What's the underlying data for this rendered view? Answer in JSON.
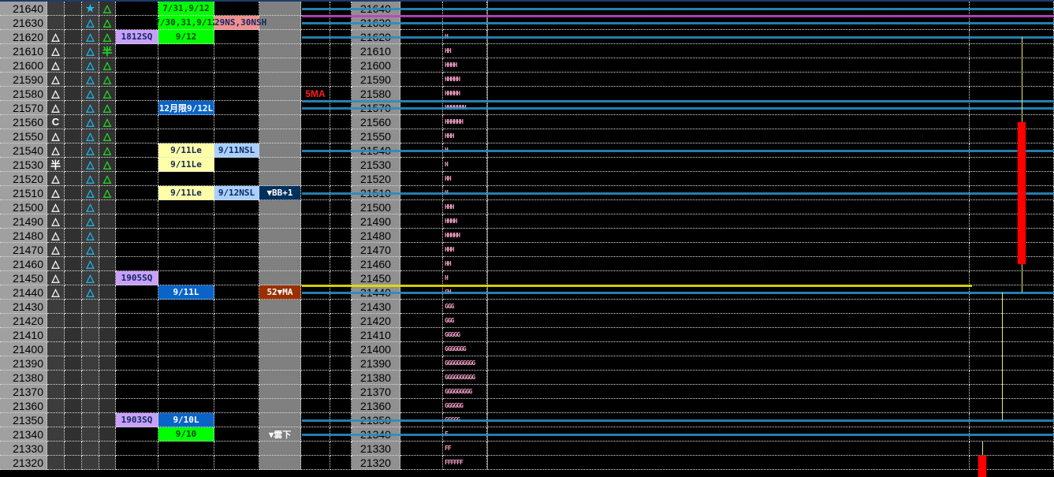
{
  "prices": [
    21640,
    21630,
    21620,
    21610,
    21600,
    21590,
    21580,
    21570,
    21560,
    21550,
    21540,
    21530,
    21520,
    21510,
    21500,
    21490,
    21480,
    21470,
    21460,
    21450,
    21440,
    21430,
    21420,
    21410,
    21400,
    21390,
    21380,
    21370,
    21360,
    21350,
    21340,
    21330,
    21320
  ],
  "marker_col_a": {
    "21620": "△",
    "21610": "△",
    "21600": "△",
    "21590": "△",
    "21580": "△",
    "21570": "△",
    "21560": "C",
    "21550": "△",
    "21540": "△",
    "21530": "半",
    "21520": "△",
    "21510": "△",
    "21500": "△",
    "21490": "△",
    "21480": "△",
    "21470": "△",
    "21460": "△",
    "21450": "△",
    "21440": "△"
  },
  "marker_col_b": {
    "21640": "★",
    "21630": "△",
    "21620": "△",
    "21610": "△",
    "21600": "△",
    "21590": "△",
    "21580": "△",
    "21570": "△",
    "21560": "△",
    "21550": "△",
    "21540": "△",
    "21530": "△",
    "21520": "△",
    "21510": "△",
    "21500": "△",
    "21490": "△",
    "21480": "△",
    "21470": "△",
    "21460": "△",
    "21450": "△",
    "21440": "△"
  },
  "marker_col_c": {
    "21640": "△",
    "21630": "△",
    "21620": "△",
    "21610": "半",
    "21600": "△",
    "21590": "△",
    "21580": "△",
    "21570": "△",
    "21560": "△",
    "21550": "△",
    "21540": "△",
    "21530": "△",
    "21520": "△",
    "21510": "△"
  },
  "labels": [
    {
      "price": 21620,
      "col": "sq",
      "text": "1812SQ",
      "style": "purple"
    },
    {
      "price": 21450,
      "col": "sq",
      "text": "1905SQ",
      "style": "purple"
    },
    {
      "price": 21350,
      "col": "sq",
      "text": "1903SQ",
      "style": "purple"
    },
    {
      "price": 21640,
      "col": "date",
      "text": "7/31,9/12",
      "style": "green"
    },
    {
      "price": 21630,
      "col": "date",
      "text": "7/30,31,9/12",
      "style": "green"
    },
    {
      "price": 21620,
      "col": "date",
      "text": "9/12",
      "style": "green"
    },
    {
      "price": 21570,
      "col": "date",
      "text": "12月限9/12L",
      "style": "blue"
    },
    {
      "price": 21540,
      "col": "date",
      "text": "9/11Le",
      "style": "yellow"
    },
    {
      "price": 21530,
      "col": "date",
      "text": "9/11Le",
      "style": "yellow"
    },
    {
      "price": 21510,
      "col": "date",
      "text": "9/11Le",
      "style": "yellow"
    },
    {
      "price": 21440,
      "col": "date",
      "text": "9/11L",
      "style": "blue"
    },
    {
      "price": 21350,
      "col": "date",
      "text": "9/10L",
      "style": "blue"
    },
    {
      "price": 21340,
      "col": "date",
      "text": "9/10",
      "style": "green"
    },
    {
      "price": 21630,
      "col": "ns",
      "text": "29NS,30NSH",
      "style": "pink"
    },
    {
      "price": 21540,
      "col": "ns",
      "text": "9/11NSL",
      "style": "lightblue"
    },
    {
      "price": 21510,
      "col": "ns",
      "text": "9/12NSL",
      "style": "lightblue"
    },
    {
      "price": 21510,
      "col": "ind",
      "text": "▼BB+1",
      "style": "navy"
    },
    {
      "price": 21440,
      "col": "ind",
      "text": "52▼MA",
      "style": "brown"
    },
    {
      "price": 21340,
      "col": "ind",
      "text": "▼雲下",
      "style": "grayw"
    },
    {
      "price": 21580,
      "col": "ma",
      "text": "5MA",
      "style": "red"
    }
  ],
  "profile": {
    "21620": "H",
    "21610": "HH",
    "21600": "HHHH",
    "21590": "HHHHH",
    "21580": "HHHHH",
    "21570": "HHHHHHH",
    "21560": "HHHHHH",
    "21550": "HHH",
    "21540": "H",
    "21530": "H",
    "21520": "HH",
    "21510": "H",
    "21500": "HHH",
    "21490": "HHHH",
    "21480": "HHHHH",
    "21470": "HHH",
    "21460": "HH",
    "21450": "H",
    "21440": "GH",
    "21430": "GGG",
    "21420": "GGG",
    "21410": "GGGGG",
    "21400": "GGGGGGG",
    "21390": "GGGGGGGGGG",
    "21380": "GGGGGGGGGG",
    "21370": "GGGGGGGGG",
    "21360": "GGGGGG",
    "21350": "GGGGG",
    "21340": "F",
    "21330": "FF",
    "21320": "FFFFFF"
  },
  "colors": {
    "purple": "#c8a0f8",
    "green": "#00ff00",
    "blue": "#0a64c8",
    "yellow": "#ffffa8",
    "pink": "#f09090",
    "lightblue": "#a8d0ff",
    "navy": "#00305c",
    "brown": "#983000",
    "grayw": "#808080",
    "red": "#ff2020",
    "level_line": "#2a8cc0",
    "magenta_line": "#c040c0",
    "yellow_line": "#e8e000",
    "candle": "#ff0000",
    "wick": "#e8e870"
  },
  "levels": {
    "blue": [
      21640,
      21630,
      21620,
      21575,
      21570,
      21540,
      21510,
      21440,
      21350,
      21340
    ],
    "magenta": [
      21635
    ],
    "yellow": [
      21445
    ]
  },
  "candles": [
    {
      "high": 21620,
      "open": 21560,
      "close": 21460,
      "low": 21440
    },
    {
      "high": 21440,
      "open": 21350,
      "close": 21350,
      "low": 21350
    },
    {
      "high": 21335,
      "open": 21325,
      "close": 21310,
      "low": 21310
    }
  ]
}
